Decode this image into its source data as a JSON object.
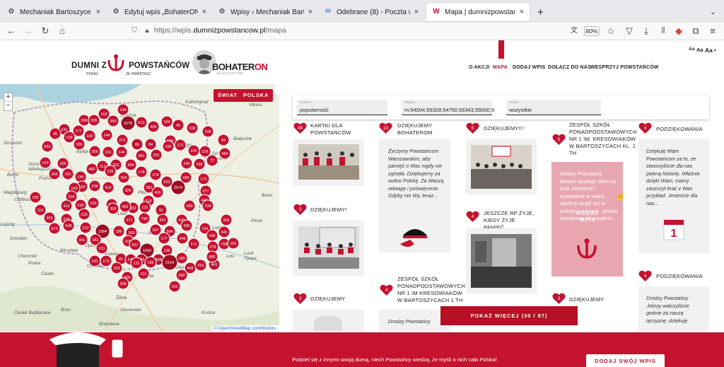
{
  "browser": {
    "tabs": [
      {
        "title": "Mechaniak Bartoszyce - Nasza Ł",
        "fav": "⚙"
      },
      {
        "title": "Edytuj wpis „BohaterON 2023 w",
        "fav": "⚙"
      },
      {
        "title": "Wpisy ‹ Mechaniak Bartoszyce",
        "fav": "⚙"
      },
      {
        "title": "Odebrane (8) - Poczta w Interii",
        "fav": "✉"
      },
      {
        "title": "Mapa | dumnizpowstania.pl",
        "fav": "W"
      }
    ],
    "url_prefix": "https://wpis.",
    "url_domain": "dumnizpowstancow.pl",
    "url_path": "/mapa",
    "zoom": "80%"
  },
  "header": {
    "dumni": "DUMNI Z",
    "powstancow": "POWSTAŃCÓW",
    "pokaz": "POKAŻ",
    "ze_pamietasz": "ŻE PAMIĘTASZ",
    "bohater_a": "BOHATER",
    "bohater_b": "ON",
    "bohater_sub": "WŁĄCZ HISTORIĘ",
    "menu": [
      "O AKCJI",
      "MAPA",
      "DODAJ WPIS",
      "DOŁĄCZ DO NAS",
      "WESPRZYJ POWSTAŃCÓW"
    ],
    "font_sizes": [
      "Aa",
      "Aa",
      "Aa",
      "◐"
    ]
  },
  "map": {
    "btn_world": "ŚWIAT",
    "btn_poland": "POLSKA",
    "zoom_in": "+",
    "zoom_out": "−",
    "attribution": "© OpenStreetMap contributors.",
    "markers": [
      {
        "n": "144"
      },
      {
        "n": "163"
      },
      {
        "n": "268"
      },
      {
        "n": "335"
      },
      {
        "n": "369"
      },
      {
        "n": "1078"
      },
      {
        "n": "613"
      },
      {
        "n": "400"
      },
      {
        "n": "104"
      },
      {
        "n": "40"
      },
      {
        "n": "156"
      },
      {
        "n": "298"
      },
      {
        "n": "241"
      },
      {
        "n": "177"
      },
      {
        "n": "95"
      },
      {
        "n": "139"
      },
      {
        "n": "182"
      },
      {
        "n": "244"
      },
      {
        "n": "271"
      },
      {
        "n": "86"
      },
      {
        "n": "84"
      },
      {
        "n": "180"
      },
      {
        "n": "171"
      },
      {
        "n": "93"
      },
      {
        "n": "593"
      },
      {
        "n": "165"
      },
      {
        "n": "309"
      },
      {
        "n": "151"
      },
      {
        "n": "144"
      },
      {
        "n": "481"
      },
      {
        "n": "291"
      },
      {
        "n": "106"
      },
      {
        "n": "243"
      },
      {
        "n": "216"
      },
      {
        "n": "484"
      },
      {
        "n": "143"
      },
      {
        "n": "325"
      },
      {
        "n": "482"
      },
      {
        "n": "113"
      },
      {
        "n": "331"
      },
      {
        "n": "304"
      },
      {
        "n": "240"
      },
      {
        "n": "198"
      },
      {
        "n": "77"
      },
      {
        "n": "299"
      },
      {
        "n": "191"
      },
      {
        "n": "145"
      },
      {
        "n": "235"
      },
      {
        "n": "304"
      },
      {
        "n": "178"
      },
      {
        "n": "274"
      },
      {
        "n": "522"
      },
      {
        "n": "286"
      },
      {
        "n": "171"
      },
      {
        "n": "183"
      },
      {
        "n": "239"
      },
      {
        "n": "314"
      },
      {
        "n": "326"
      },
      {
        "n": "281"
      },
      {
        "n": "2974"
      },
      {
        "n": "277"
      },
      {
        "n": "160"
      },
      {
        "n": "100"
      },
      {
        "n": "204"
      },
      {
        "n": "229"
      },
      {
        "n": "313"
      },
      {
        "n": "302"
      },
      {
        "n": "318"
      },
      {
        "n": "426"
      },
      {
        "n": "446"
      },
      {
        "n": "116"
      },
      {
        "n": "412"
      },
      {
        "n": "228"
      },
      {
        "n": "392"
      },
      {
        "n": "465"
      },
      {
        "n": "131"
      },
      {
        "n": "289"
      },
      {
        "n": "234"
      },
      {
        "n": "91"
      },
      {
        "n": "263"
      },
      {
        "n": "218"
      },
      {
        "n": "133"
      },
      {
        "n": "271"
      },
      {
        "n": "760"
      },
      {
        "n": "337"
      },
      {
        "n": "429"
      },
      {
        "n": "328"
      },
      {
        "n": "673"
      },
      {
        "n": "548"
      },
      {
        "n": "212"
      },
      {
        "n": "1084"
      },
      {
        "n": "186"
      },
      {
        "n": "300"
      },
      {
        "n": "307"
      },
      {
        "n": "584"
      },
      {
        "n": "395"
      },
      {
        "n": "341"
      },
      {
        "n": "159"
      },
      {
        "n": "557"
      },
      {
        "n": "177"
      },
      {
        "n": "246"
      },
      {
        "n": "154"
      },
      {
        "n": "156"
      },
      {
        "n": "341"
      },
      {
        "n": "341"
      },
      {
        "n": "151"
      },
      {
        "n": "1655"
      },
      {
        "n": "136"
      },
      {
        "n": "171"
      },
      {
        "n": "378"
      },
      {
        "n": "758"
      },
      {
        "n": "101"
      },
      {
        "n": "141"
      },
      {
        "n": "173"
      },
      {
        "n": "81"
      },
      {
        "n": "245"
      },
      {
        "n": "265"
      },
      {
        "n": "308"
      },
      {
        "n": "180"
      },
      {
        "n": "153"
      },
      {
        "n": "131"
      },
      {
        "n": "185"
      },
      {
        "n": "3154"
      },
      {
        "n": "445"
      },
      {
        "n": "291"
      },
      {
        "n": "441"
      },
      {
        "n": "882"
      },
      {
        "n": "400"
      },
      {
        "n": "309"
      },
      {
        "n": "121"
      },
      {
        "n": "282"
      },
      {
        "n": "101"
      },
      {
        "n": "262"
      }
    ],
    "places": [
      "Kaliningrad",
      "Vilnius",
      "Gdańsk",
      "Gorzów",
      "Wielkopolski",
      "Poznań",
      "Płock",
      "Warszawa",
      "Grodno",
      "Гродна",
      "Berlin",
      "Lublin",
      "Łódź",
      "Wrocław",
      "Praha",
      "Česko",
      "Ostrava",
      "Kraków",
      "Rzeszów",
      "Lviv",
      "Žilina",
      "Bratislava",
      "Slovensko",
      "Košice",
      "Brno",
      "České Budějovice",
      "Szczecin",
      "Bydgoszcz",
      "Toruń",
      "Olsztyn",
      "Białystok",
      "Kielce",
      "Katowice",
      "Opole",
      "Cottbus",
      "Leipzig",
      "Dresden",
      "Chemnitz",
      "Luck",
      "Луцьк",
      "Brest",
      "Pinsk",
      "Magdeburg"
    ]
  },
  "filter": {
    "f1_label": "SORTUJ",
    "f1_value": "popularność",
    "f2_label": "SZUKAJ",
    "f2_value": "m:54004,56328,54750,56343,55000,563",
    "f3_label": "POKAŻ",
    "f3_value": "wszystkie"
  },
  "cards": [
    {
      "count": "49",
      "title": "KARTKI DLA POWSTAŃCÓW"
    },
    {
      "count": "3",
      "title": "DZIĘKUJEMY!"
    },
    {
      "count": "3",
      "title": "DZIĘKUJEMY"
    },
    {
      "count": "10",
      "title": "DZIĘKUJEMY BOHATEROM",
      "text": "Życzymy Powstańcom Warszawskim, aby pamięć o Was nigdy nie zginęła. Dziękujemy za wolno Polskę. Za Waszą odwagę i poświęcenie. Gdyby nie Wy, teraz..."
    },
    {
      "count": "4",
      "title": "ZESPÓŁ SZKÓŁ PONADPODSTAWOWYCH NR 1 IM KRESOWIAKÓW W BARTOSZYCACH 1 TH",
      "text": "Drodzy Powstańcy"
    },
    {
      "count": "5",
      "title": "DZIĘKUJEMY!!!"
    },
    {
      "count": "4",
      "title": "JESZCZE RP ŻYJE, KIEDY ŻYJE PAMIĘĆ"
    },
    {
      "count": "5",
      "title": "ZESPÓŁ SZKÓŁ PONADPODSTAWOWYCH NR 1 IM. KRESOWIAKÓW W BARTOSZYCACH KL. 1 TH",
      "text": "Drodzy Powstańcy Bardzo dziękuję Wam za trud, cierpienie i wytrwałość w walce, abyśmy mogli żyć w wolnym państwie. Jestem wdzięczna, że mogłem...",
      "overlay": "DODAJ WPIS"
    },
    {
      "count": "3",
      "title": "DZIĘKUJEMY"
    },
    {
      "count": "4",
      "title": "PODZIĘKOWANIA",
      "text": "Dziękuję Wam Powstańcom za to, że stworzyliście dla nas piękną historię. Właśnie dzięki Wam, mamy zaszczyt brać z Was przykład. Jesteście dla nas..."
    },
    {
      "count": "4",
      "title": "PODZIĘKOWANIA",
      "text": "Drodzy Powstańcy ,którzy walczyliście godnie za naszą ojczyznę ,dziękuję"
    }
  ],
  "bottom": {
    "show_more": "POKAŻ WIĘCEJ (30 / 87)",
    "banner_text": "Podziel się z innymi swoją dumą, niech Powstańcy wiedzą, że myśli o nich cała Polska!",
    "add_entry": "DODAJ SWÓJ WPIS"
  },
  "colors": {
    "brand": "#c4122f"
  }
}
